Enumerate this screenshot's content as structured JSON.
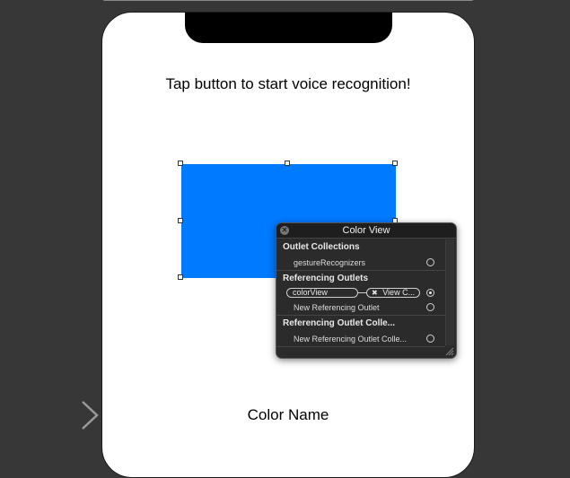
{
  "screen": {
    "prompt_text": "Tap button to start voice recognition!",
    "color_view_color": "#007aff",
    "color_name_label": "Color Name"
  },
  "popover": {
    "title": "Color View",
    "sections": {
      "outlet_collections": {
        "title": "Outlet Collections",
        "items": [
          "gestureRecognizers"
        ]
      },
      "referencing_outlets": {
        "title": "Referencing Outlets",
        "connection": {
          "outlet": "colorView",
          "target": "View C..."
        },
        "new_item": "New Referencing Outlet"
      },
      "referencing_outlet_collections": {
        "title": "Referencing Outlet Colle...",
        "new_item": "New Referencing Outlet Colle..."
      }
    }
  },
  "icons": {
    "close": "close-icon",
    "remove_connection": "x-small-icon",
    "resize": "resize-grip-icon",
    "entry_point": "arrow-right-icon"
  }
}
